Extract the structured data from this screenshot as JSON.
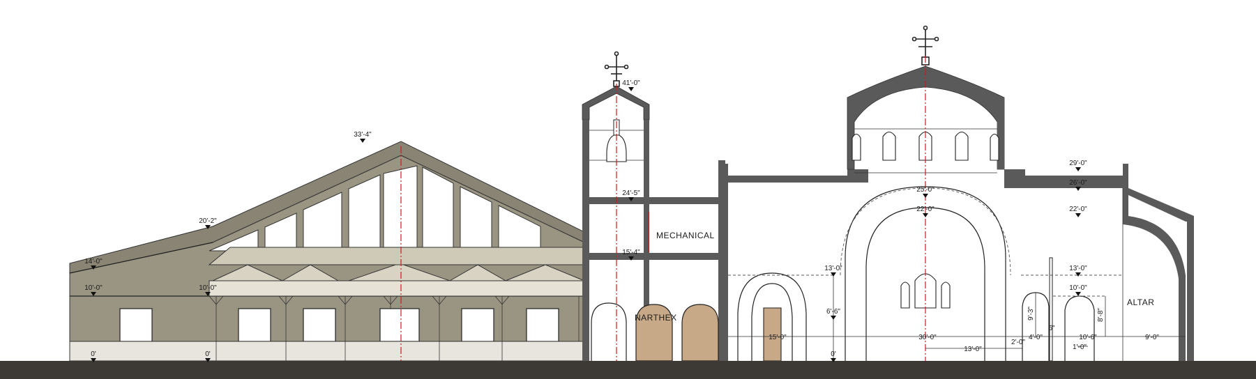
{
  "elevation_marks": [
    {
      "id": "hall-33-4",
      "text": "33'-4\""
    },
    {
      "id": "hall-20-2",
      "text": "20'-2\""
    },
    {
      "id": "hall-14-0",
      "text": "14'-0\""
    },
    {
      "id": "hall-10-0-left",
      "text": "10'-0\""
    },
    {
      "id": "hall-10-0-mid",
      "text": "10'-0\""
    },
    {
      "id": "hall-0-left",
      "text": "0'"
    },
    {
      "id": "hall-0-mid",
      "text": "0'"
    },
    {
      "id": "tower-41-0",
      "text": "41'-0\""
    },
    {
      "id": "tower-24-5",
      "text": "24'-5\""
    },
    {
      "id": "tower-15-4",
      "text": "15'-4\""
    },
    {
      "id": "nave-25-0",
      "text": "25'-0\""
    },
    {
      "id": "nave-22-0",
      "text": "22'-0\""
    },
    {
      "id": "nave-13-0",
      "text": "13'-0\""
    },
    {
      "id": "nave-6-6",
      "text": "6'-6\""
    },
    {
      "id": "nave-0",
      "text": "0'"
    },
    {
      "id": "altar-29-0",
      "text": "29'-0\""
    },
    {
      "id": "altar-26-0",
      "text": "26'-0\""
    },
    {
      "id": "altar-22-0",
      "text": "22'-0\""
    },
    {
      "id": "altar-13-0",
      "text": "13'-0\""
    },
    {
      "id": "altar-10-0",
      "text": "10'-0\""
    }
  ],
  "dimensions": [
    {
      "id": "dim-15-0",
      "text": "15'-0\""
    },
    {
      "id": "dim-30-0",
      "text": "30'-0\""
    },
    {
      "id": "dim-13-0",
      "text": "13'-0\""
    },
    {
      "id": "dim-2-0",
      "text": "2'-0\""
    },
    {
      "id": "dim-4-0",
      "text": "4'-0\""
    },
    {
      "id": "dim-10-6",
      "text": "10'-6\""
    },
    {
      "id": "dim-9-0",
      "text": "9'-0\""
    },
    {
      "id": "dim-1-0",
      "text": "1'-0\""
    },
    {
      "id": "dim-9-3",
      "text": "9'-3\""
    },
    {
      "id": "dim-6",
      "text": "6\""
    },
    {
      "id": "dim-8-8",
      "text": "8'-8\""
    }
  ],
  "rooms": {
    "mechanical": "MECHANICAL",
    "narthex": "NARTHEX",
    "altar": "ALTAR"
  },
  "colors": {
    "hall_wall": "#9a9482",
    "hall_roof": "#8a8475",
    "hall_canopy": "#d8d3c3",
    "hall_base": "#e8e5df",
    "door_fill": "#c8a987",
    "section_cut": "#5a5a5a",
    "ground": "#3d3935",
    "centerline": "#d21919"
  }
}
